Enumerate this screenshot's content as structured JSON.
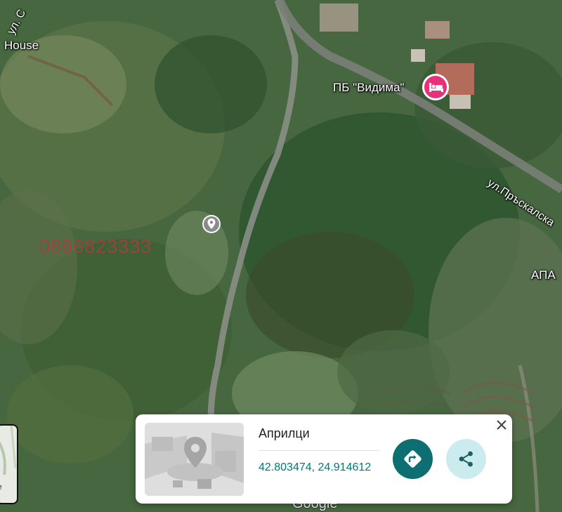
{
  "map": {
    "labels": {
      "street_top": "ул. С",
      "house": "House",
      "hotel": "ПБ \"Видима\"",
      "street_right": "ул.Пръскалска",
      "right_edge": "АПА"
    },
    "watermark": "0896823333",
    "hotel_pin_icon": "bed-icon",
    "hotel_pin_color": "#e8317b",
    "location_pin_icon": "map-pin-icon",
    "layers_thumb_text": "e",
    "attribution": "Google"
  },
  "card": {
    "title": "Априлци",
    "coordinates": "42.803474, 24.914612",
    "thumbnail_icon": "place-photo-placeholder",
    "directions_icon": "directions-icon",
    "share_icon": "share-icon",
    "close_icon": "close-icon",
    "accent": "#0e6f72",
    "share_bg": "#cbecee"
  }
}
